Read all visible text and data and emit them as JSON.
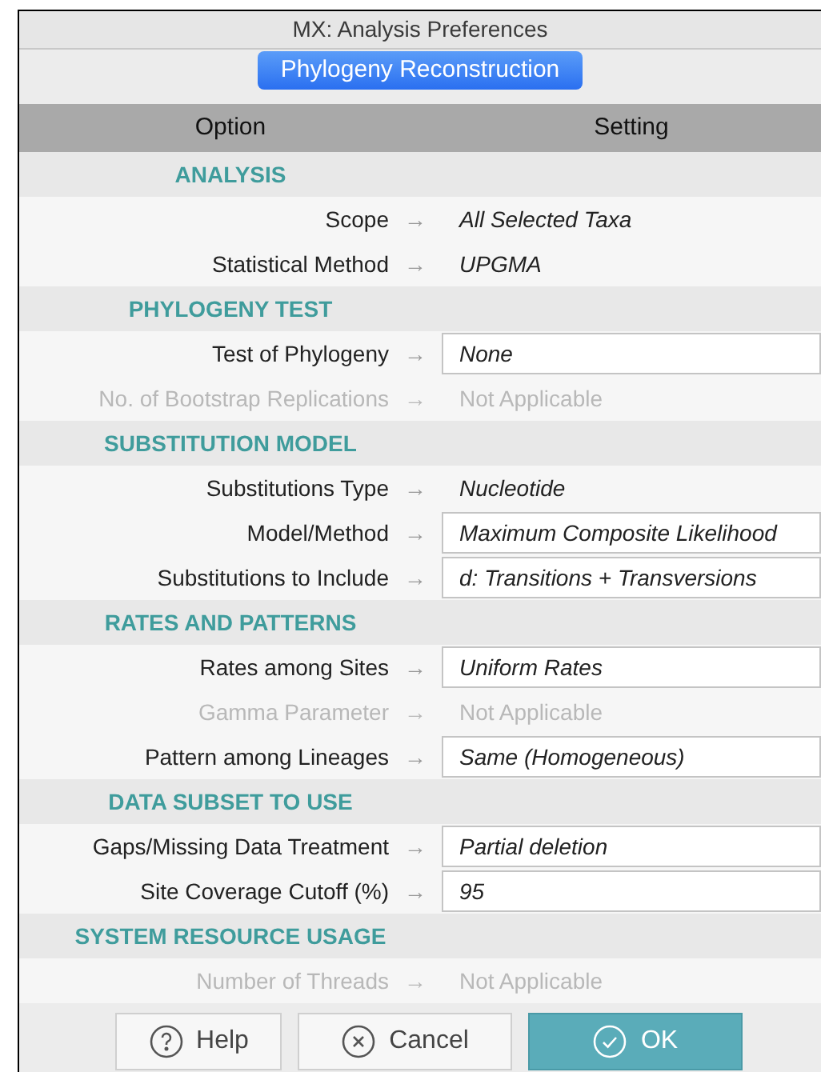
{
  "window": {
    "title": "MX: Analysis Preferences"
  },
  "tabs": [
    {
      "label": "Phylogeny Reconstruction",
      "selected": true
    }
  ],
  "table": {
    "columns": [
      "Option",
      "Setting"
    ],
    "rows": [
      {
        "kind": "section",
        "label": "ANALYSIS"
      },
      {
        "kind": "text",
        "label": "Scope",
        "arrow": "→",
        "value": "All Selected Taxa",
        "disabled": false
      },
      {
        "kind": "text",
        "label": "Statistical Method",
        "arrow": "→",
        "value": "UPGMA",
        "disabled": false
      },
      {
        "kind": "section",
        "label": "PHYLOGENY TEST"
      },
      {
        "kind": "field",
        "label": "Test of Phylogeny",
        "arrow": "→",
        "value": "None",
        "disabled": false
      },
      {
        "kind": "text",
        "label": "No. of Bootstrap Replications",
        "arrow": "→",
        "value": "Not Applicable",
        "disabled": true
      },
      {
        "kind": "section",
        "label": "SUBSTITUTION MODEL"
      },
      {
        "kind": "text",
        "label": "Substitutions Type",
        "arrow": "→",
        "value": "Nucleotide",
        "disabled": false
      },
      {
        "kind": "field",
        "label": "Model/Method",
        "arrow": "→",
        "value": "Maximum Composite Likelihood",
        "disabled": false
      },
      {
        "kind": "field",
        "label": "Substitutions to Include",
        "arrow": "→",
        "value": "d: Transitions + Transversions",
        "disabled": false
      },
      {
        "kind": "section",
        "label": "RATES AND PATTERNS"
      },
      {
        "kind": "field",
        "label": "Rates among Sites",
        "arrow": "→",
        "value": "Uniform Rates",
        "disabled": false
      },
      {
        "kind": "text",
        "label": "Gamma Parameter",
        "arrow": "→",
        "value": "Not Applicable",
        "disabled": true
      },
      {
        "kind": "field",
        "label": "Pattern among Lineages",
        "arrow": "→",
        "value": "Same (Homogeneous)",
        "disabled": false
      },
      {
        "kind": "section",
        "label": "DATA SUBSET TO USE"
      },
      {
        "kind": "field",
        "label": "Gaps/Missing Data Treatment",
        "arrow": "→",
        "value": "Partial deletion",
        "disabled": false
      },
      {
        "kind": "field",
        "label": "Site Coverage Cutoff (%)",
        "arrow": "→",
        "value": "95",
        "disabled": false
      },
      {
        "kind": "section",
        "label": "SYSTEM RESOURCE USAGE"
      },
      {
        "kind": "text",
        "label": "Number of Threads",
        "arrow": "→",
        "value": "Not Applicable",
        "disabled": true
      }
    ]
  },
  "buttons": [
    {
      "kind": "help",
      "label": "Help",
      "default": false
    },
    {
      "kind": "cancel",
      "label": "Cancel",
      "default": false
    },
    {
      "kind": "ok",
      "label": "OK",
      "default": true
    }
  ]
}
